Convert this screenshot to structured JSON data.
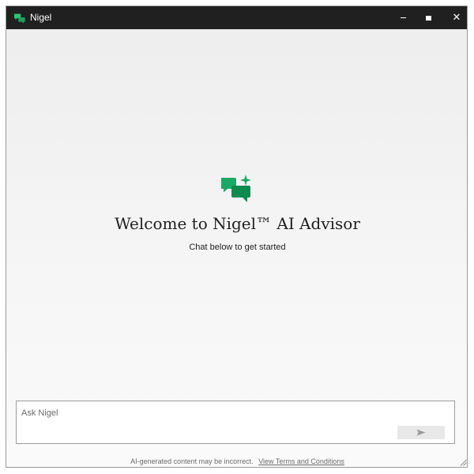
{
  "window": {
    "title": "Nigel",
    "app_icon": "chat-bubbles-icon",
    "controls": {
      "minimize_icon": "minimize-icon",
      "maximize_icon": "maximize-icon",
      "close_icon": "close-icon",
      "close_glyph": "✕"
    }
  },
  "main": {
    "hero_icon": "chat-bubbles-sparkle-icon",
    "title": "Welcome to Nigel™ AI Advisor",
    "subtitle": "Chat below to get started"
  },
  "composer": {
    "placeholder": "Ask Nigel",
    "send_icon": "send-arrow-icon"
  },
  "footer": {
    "disclaimer": "AI-generated content may be incorrect.",
    "link_label": "View Terms and Conditions"
  },
  "colors": {
    "accent": "#1a9a5c",
    "accent_dark": "#0f7a44",
    "titlebar": "#202020"
  }
}
